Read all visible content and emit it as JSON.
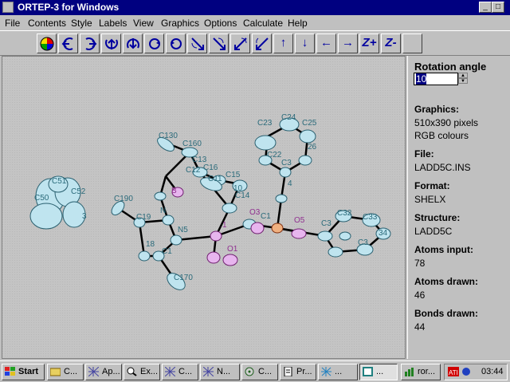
{
  "window": {
    "title": "ORTEP-3 for Windows"
  },
  "menu": [
    "File",
    "Contents",
    "Style",
    "Labels",
    "View",
    "Graphics",
    "Options",
    "Calculate",
    "Help"
  ],
  "toolbar": {
    "icons": [
      "color-wheel-icon",
      "rotate-x-left-icon",
      "rotate-x-right-icon",
      "rotate-y-up-icon",
      "rotate-y-down-icon",
      "rotate-z-ccw-icon",
      "rotate-z-cw-icon",
      "rotate-xy-1-icon",
      "rotate-xy-2-icon",
      "rotate-xy-3-icon",
      "rotate-xy-4-icon",
      "arrow-up-icon",
      "arrow-down-icon",
      "arrow-left-icon",
      "arrow-right-icon",
      "z-plus-icon",
      "z-minus-icon"
    ],
    "z_plus": "Z+",
    "z_minus": "Z-"
  },
  "panel": {
    "rotation_label": "Rotation angle",
    "rotation_value": "10",
    "graphics_label": "Graphics:",
    "graphics_value1": "510x390 pixels",
    "graphics_value2": "RGB  colours",
    "file_label": "File:",
    "file_value": "LADD5C.INS",
    "format_label": "Format:",
    "format_value": "SHELX",
    "structure_label": "Structure:",
    "structure_value": "LADD5C",
    "atoms_input_label": "Atoms input:",
    "atoms_input_value": "78",
    "atoms_drawn_label": "Atoms drawn:",
    "atoms_drawn_value": "46",
    "bonds_drawn_label": "Bonds drawn:",
    "bonds_drawn_value": "44"
  },
  "molecule_labels": {
    "c130": "C130",
    "c160": "C160",
    "c13": "C13",
    "c12": "C12",
    "c16": "C16",
    "c11": "C11",
    "c15": "C15",
    "c10": "10",
    "c14": "C14",
    "br": "B",
    "n": "N",
    "c19": "C19",
    "c190": "C190",
    "c18": "18",
    "n5": "N5",
    "c1": "C1",
    "c170": "C170",
    "o1": "O1",
    "x1": "1",
    "o3": "O3",
    "c1x": "C1",
    "o5": "O5",
    "c4": "4",
    "c3": "C3",
    "c22": "C22",
    "c23": "C23",
    "c24": "C24",
    "c25": "C25",
    "c26": "26",
    "c31": "C3",
    "c32": "C32",
    "c33": "C33",
    "c34": "34",
    "c35": "C3",
    "c51": "C51",
    "c52": "C52",
    "c50": "C50",
    "c53": "3"
  },
  "taskbar": {
    "start": "Start",
    "tasks": [
      "C...",
      "Ap...",
      "Ex...",
      "C...",
      "N...",
      "C...",
      "Pr...",
      "...",
      "...",
      "ror..."
    ],
    "clock": "03:44"
  }
}
